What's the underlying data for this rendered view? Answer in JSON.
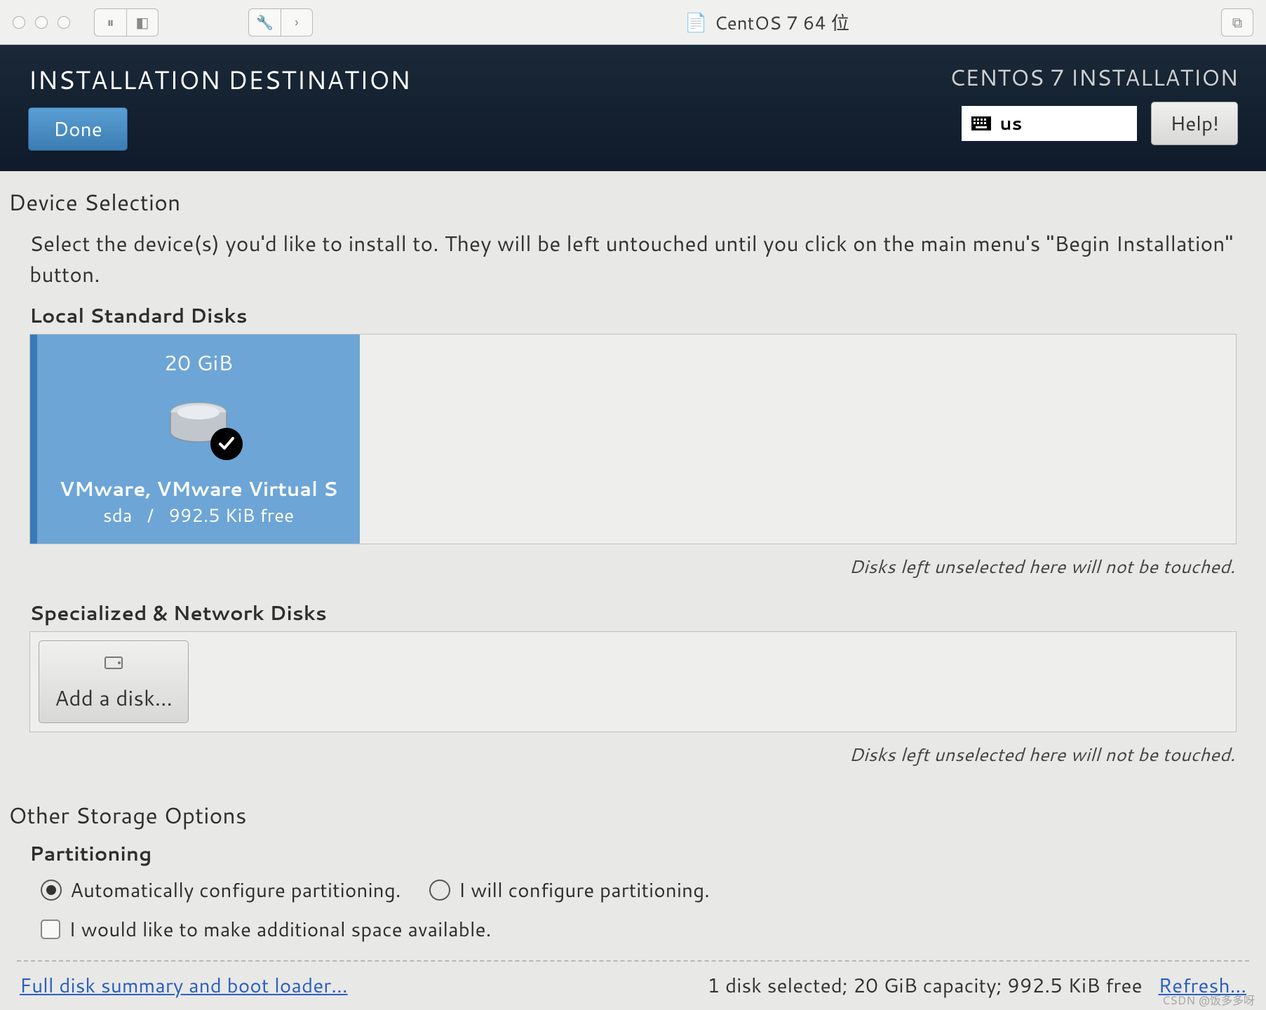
{
  "window": {
    "title": "CentOS 7 64 位"
  },
  "header": {
    "page_title": "INSTALLATION DESTINATION",
    "done_label": "Done",
    "product_title": "CENTOS 7 INSTALLATION",
    "keyboard_layout": "us",
    "help_label": "Help!"
  },
  "device_selection": {
    "heading": "Device Selection",
    "description": "Select the device(s) you'd like to install to.  They will be left untouched until you click on the main menu's \"Begin Installation\" button.",
    "local_heading": "Local Standard Disks",
    "disk": {
      "capacity": "20 GiB",
      "model": "VMware, VMware Virtual S",
      "device": "sda",
      "sep": "/",
      "free": "992.5 KiB free"
    },
    "unselected_note": "Disks left unselected here will not be touched.",
    "network_heading": "Specialized & Network Disks",
    "add_disk_label": "Add a disk..."
  },
  "storage_options": {
    "heading": "Other Storage Options",
    "partitioning_heading": "Partitioning",
    "auto_label": "Automatically configure partitioning.",
    "manual_label": "I will configure partitioning.",
    "reclaim_label": "I would like to make additional space available."
  },
  "footer": {
    "summary_link": "Full disk summary and boot loader...",
    "status": "1 disk selected; 20 GiB capacity; 992.5 KiB free",
    "refresh_link": "Refresh..."
  },
  "watermark": "CSDN @饭多多呀"
}
